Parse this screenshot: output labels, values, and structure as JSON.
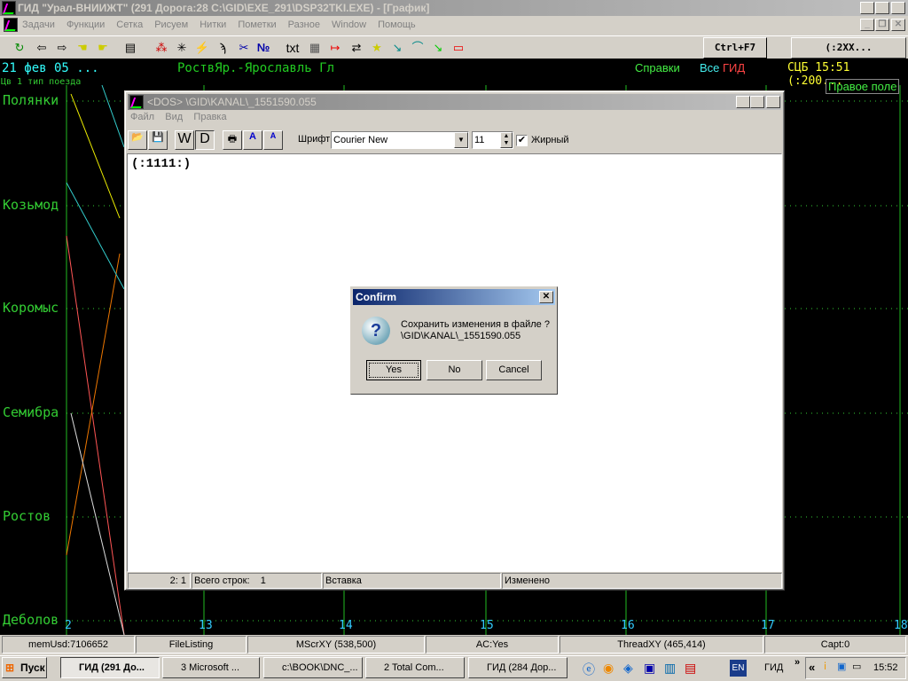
{
  "app": {
    "title": "ГИД \"Урал-ВНИИЖТ\" (291 Дорога:28 C:\\GID\\EXE_291\\DSP32TKI.EXE) - [График]"
  },
  "menu": [
    "Задачи",
    "Функции",
    "Сетка",
    "Рисуем",
    "Нитки",
    "Пометки",
    "Разное",
    "Window",
    "Помощь"
  ],
  "toolbar": {
    "txt": "txt",
    "ctrl_f7": "Ctrl+F7",
    "twoxx": "(:2XX...",
    "number_sign": "№"
  },
  "graph": {
    "date": "21 фев 05 ...",
    "route": "РоствЯр.-Ярославль Гл",
    "spravki": "Справки",
    "vse": "Все",
    "gid": "ГИД",
    "scb": "СЦБ 15:51 (:200...",
    "train_type": "Цв 1 тип поезда",
    "right_field": "Правое поле",
    "stations": [
      "Полянки",
      "Козьмод",
      "Коромыс",
      "Семибра",
      "Ростов",
      "Деболов"
    ],
    "hours": [
      "2",
      "13",
      "14",
      "15",
      "16",
      "17",
      "18"
    ],
    "colors": {
      "station": "#33cc33",
      "hour": "#33ccff",
      "date": "#33ffff",
      "scb": "#ffff33",
      "gid": "#ff4444"
    }
  },
  "editor": {
    "title": "<DOS> \\GID\\KANAL\\_1551590.055",
    "menu": [
      "Файл",
      "Вид",
      "Правка"
    ],
    "w": "W",
    "d": "D",
    "font_label": "Шрифт:",
    "font": "Courier New",
    "size": "11",
    "bold_label": "Жирный",
    "bold": true,
    "content": "(:1111:)",
    "status": {
      "pos": "2:  1",
      "lines_label": "Всего строк:",
      "lines": "1",
      "mode": "Вставка",
      "modified": "Изменено"
    }
  },
  "dialog": {
    "title": "Confirm",
    "message": "Сохранить изменения в файле ?",
    "path": "\\GID\\KANAL\\_1551590.055",
    "yes": "Yes",
    "no": "No",
    "cancel": "Cancel"
  },
  "statusbar": [
    "memUsd:7106652",
    "FileListing",
    "MScrXY (538,500)",
    "AC:Yes",
    "ThreadXY (465,414)",
    "Capt:0"
  ],
  "taskbar": {
    "start": "Пуск",
    "tasks": [
      "ГИД (291 До...",
      "3 Microsoft ...",
      "c:\\BOOK\\DNC_...",
      "2 Total Com...",
      "ГИД (284 Дор..."
    ],
    "lang": "EN",
    "toolbar_label": "ГИД",
    "clock": "15:52"
  }
}
